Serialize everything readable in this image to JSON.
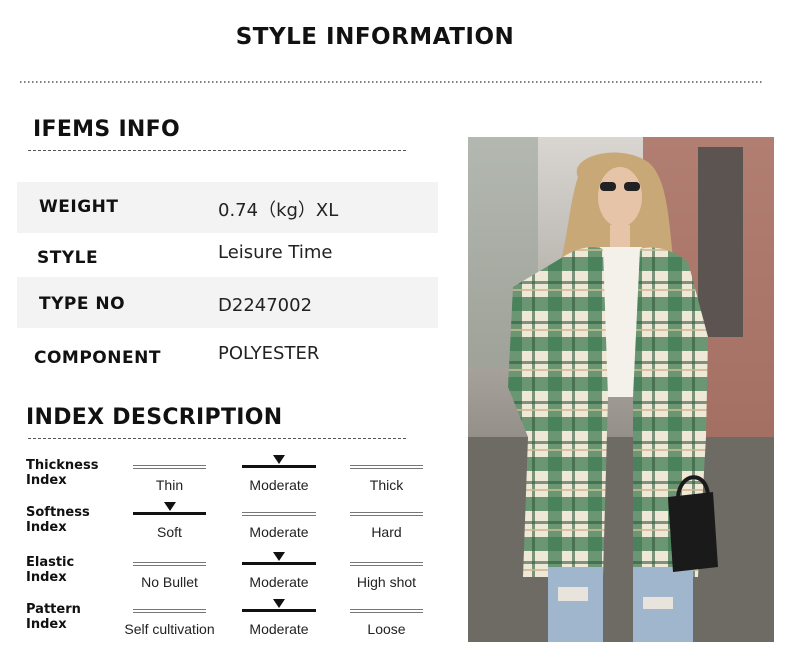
{
  "title": "STYLE INFORMATION",
  "items_info": {
    "heading": "IFEMS INFO",
    "rows": [
      {
        "label": "WEIGHT",
        "value": "0.74（kg）XL"
      },
      {
        "label": "STYLE",
        "value": "Leisure Time"
      },
      {
        "label": "TYPE NO",
        "value": "D2247002"
      },
      {
        "label": "COMPONENT",
        "value": "POLYESTER"
      }
    ]
  },
  "index_description": {
    "heading": "INDEX DESCRIPTION",
    "rows": [
      {
        "label_line1": "Thickness",
        "label_line2": "Index",
        "options": [
          "Thin",
          "Moderate",
          "Thick"
        ],
        "selected": 1
      },
      {
        "label_line1": "Softness",
        "label_line2": "Index",
        "options": [
          "Soft",
          "Moderate",
          "Hard"
        ],
        "selected": 0
      },
      {
        "label_line1": "Elastic",
        "label_line2": "Index",
        "options": [
          "No Bullet",
          "Moderate",
          "High shot"
        ],
        "selected": 1
      },
      {
        "label_line1": "Pattern",
        "label_line2": "Index",
        "options": [
          "Self cultivation",
          "Moderate",
          "Loose"
        ],
        "selected": 1
      }
    ]
  },
  "photo": {
    "icon": "model-photo",
    "colors": {
      "plaid_green": "#3f7a52",
      "plaid_cream": "#efe8d6",
      "jeans": "#9fb6cc",
      "street": "#7a7670",
      "brick": "#a8685a"
    }
  }
}
